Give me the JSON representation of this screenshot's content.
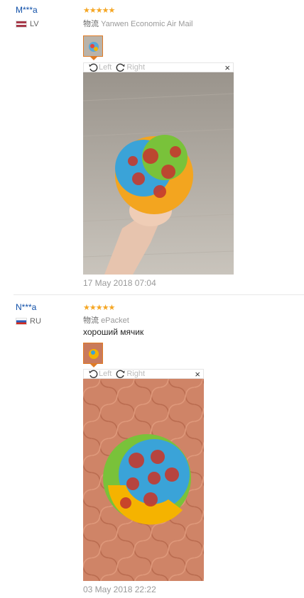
{
  "reviews": [
    {
      "user": "M***a",
      "country": "LV",
      "stars": "★★★★★",
      "shipping_label": "物流",
      "shipping_method": "Yanwen Economic Air Mail",
      "comment": "",
      "toolbar": {
        "left_label": "Left",
        "right_label": "Right",
        "close": "×"
      },
      "date": "17 May 2018 07:04"
    },
    {
      "user": "N***a",
      "country": "RU",
      "stars": "★★★★★",
      "shipping_label": "物流",
      "shipping_method": "ePacket",
      "comment": "хороший мячик",
      "toolbar": {
        "left_label": "Left",
        "right_label": "Right",
        "close": "×"
      },
      "date": "03 May 2018 22:22"
    }
  ],
  "colors": {
    "accent": "#e07b24",
    "star": "#f5a623",
    "user_link": "#0f4fa8"
  }
}
